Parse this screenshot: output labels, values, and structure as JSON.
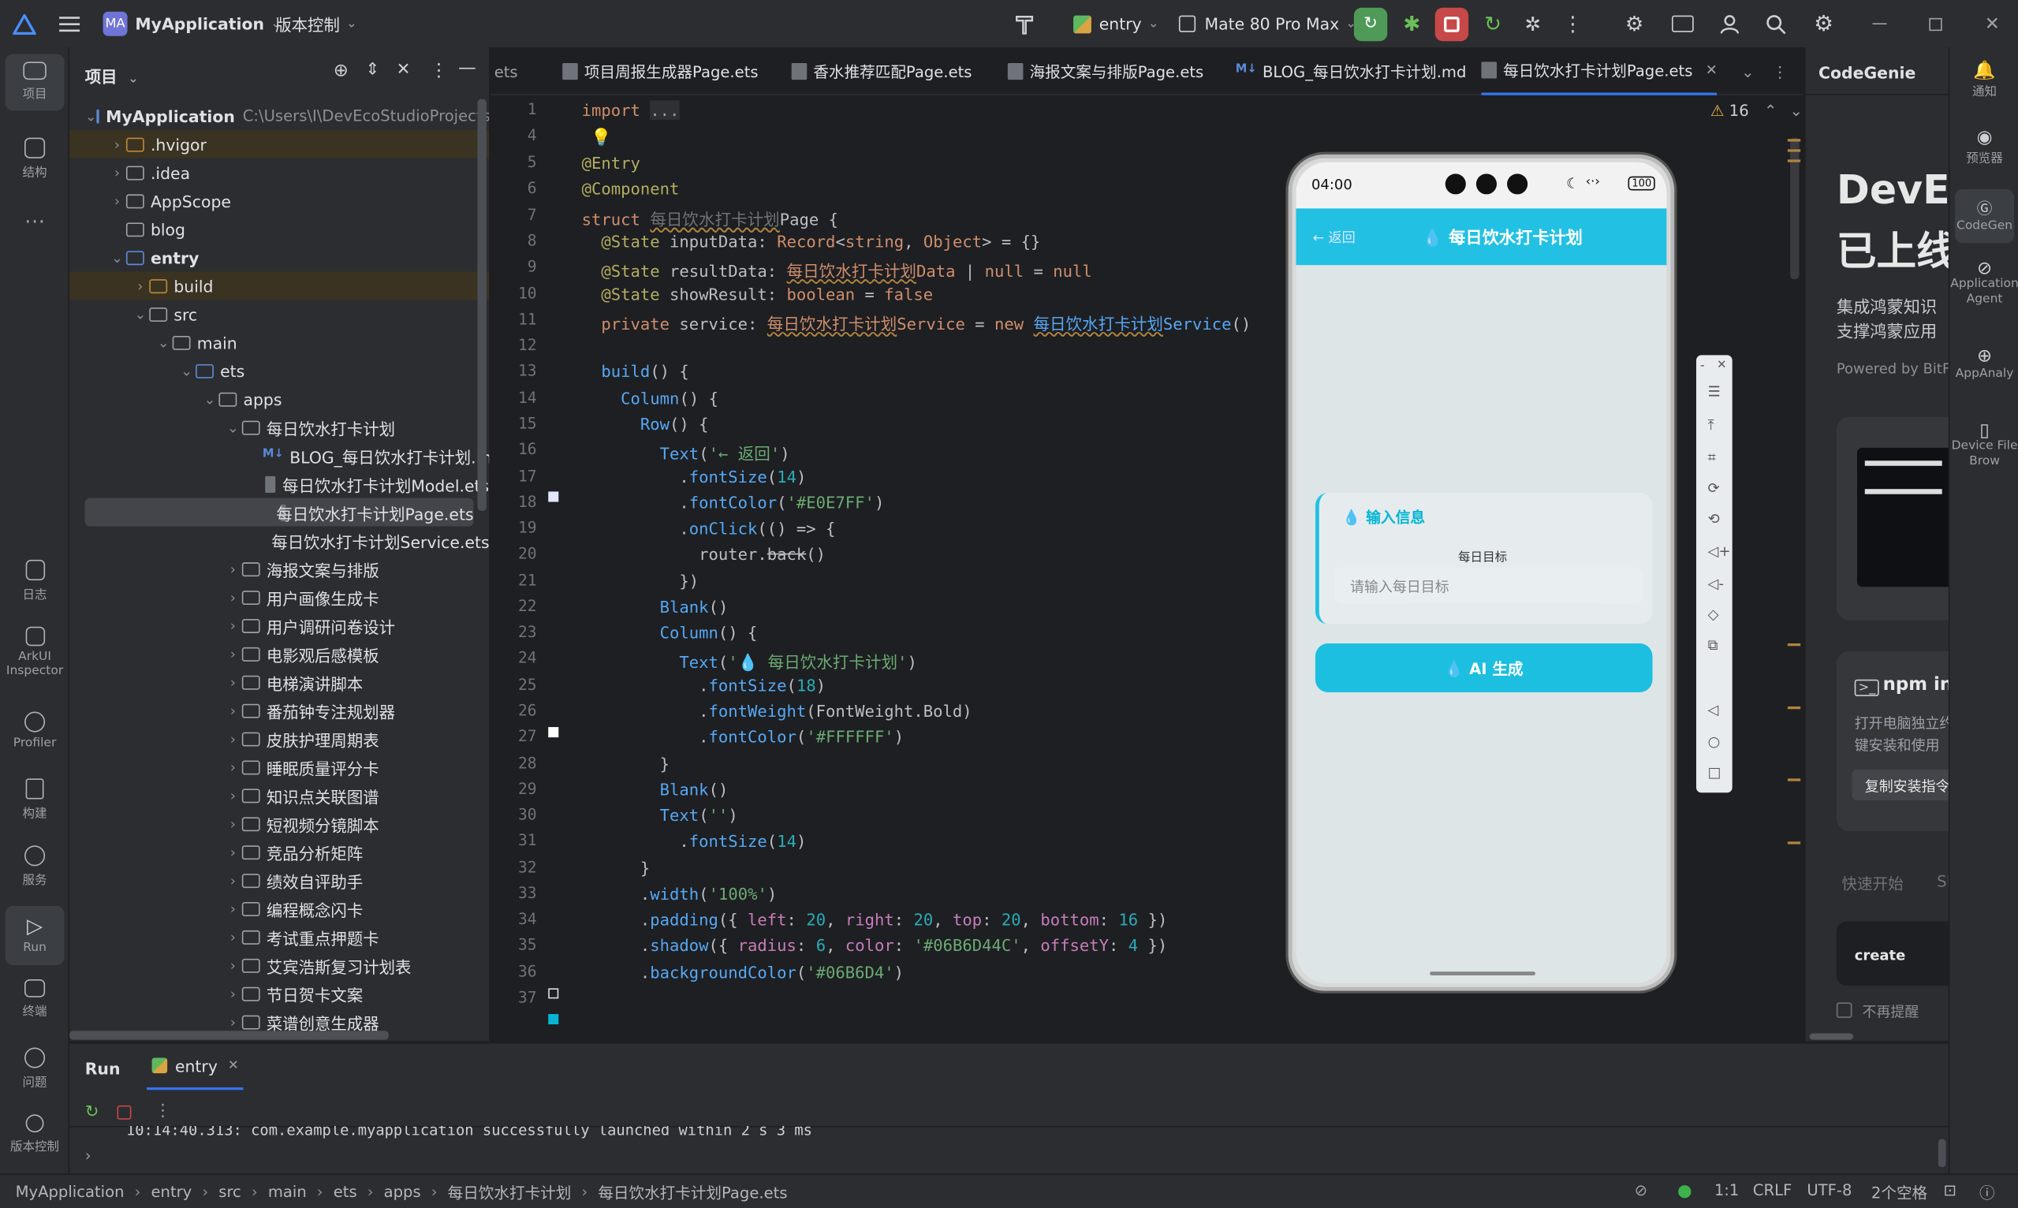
{
  "titlebar": {
    "project_badge": "MA",
    "project_name": "MyApplication",
    "vcs": "版本控制",
    "run_config": "entry",
    "device": "Mate 80 Pro Max"
  },
  "leftbar": {
    "items": [
      "项目",
      "结构",
      "日志",
      "ArkUI Inspector",
      "Profiler",
      "构建",
      "服务",
      "Run",
      "终端",
      "问题",
      "版本控制"
    ]
  },
  "project_panel": {
    "title": "项目",
    "root": "MyApplication",
    "root_path": "C:\\Users\\I\\DevEcoStudioProjects\\My",
    "tree": [
      ".hvigor",
      ".idea",
      "AppScope",
      "blog",
      "entry",
      "build",
      "src",
      "main",
      "ets",
      "apps",
      "每日饮水打卡计划",
      "BLOG_每日饮水打卡计划.md",
      "每日饮水打卡计划Model.ets",
      "每日饮水打卡计划Page.ets",
      "每日饮水打卡计划Service.ets",
      "海报文案与排版",
      "用户画像生成卡",
      "用户调研问卷设计",
      "电影观后感模板",
      "电梯演讲脚本",
      "番茄钟专注规划器",
      "皮肤护理周期表",
      "睡眠质量评分卡",
      "知识点关联图谱",
      "短视频分镜脚本",
      "竞品分析矩阵",
      "绩效自评助手",
      "编程概念闪卡",
      "考试重点押题卡",
      "艾宾浩斯复习计划表",
      "节日贺卡文案",
      "菜谱创意生成器"
    ]
  },
  "tabs": [
    "ets",
    "项目周报生成器Page.ets",
    "香水推荐匹配Page.ets",
    "海报文案与排版Page.ets",
    "BLOG_每日饮水打卡计划.md",
    "每日饮水打卡计划Page.ets"
  ],
  "editor": {
    "warnings": "16",
    "line_numbers": [
      "1",
      "4",
      "5",
      "6",
      "7",
      "8",
      "9",
      "10",
      "11",
      "12",
      "13",
      "14",
      "15",
      "16",
      "17",
      "18",
      "19",
      "20",
      "21",
      "22",
      "23",
      "24",
      "25",
      "26",
      "27",
      "28",
      "29",
      "30",
      "31",
      "32",
      "33",
      "34",
      "35",
      "36",
      "37"
    ]
  },
  "preview": {
    "time": "04:00",
    "battery": "100",
    "back_label": "← 返回",
    "title": "💧 每日饮水打卡计划",
    "card_title": "💧 输入信息",
    "field_label": "每日目标",
    "field_placeholder": "请输入每日目标",
    "button_label": "💧 AI 生成"
  },
  "codegenie": {
    "title": "CodeGenie",
    "heading1": "DevEc",
    "heading2": "已上线",
    "desc1": "集成鸿蒙知识",
    "desc2": "支撑鸿蒙应用",
    "powered": "Powered by BitFu",
    "npm_title": "npm ins",
    "npm_desc1": "打开电脑独立约",
    "npm_desc2": "键安装和使用",
    "copy_btn": "复制安装指令",
    "quick_start": "快速开始",
    "quick_si": "Sl",
    "create": "create",
    "no_remind": "不再提醒"
  },
  "rightbar": {
    "items": [
      "通知",
      "预览器",
      "CodeGen",
      "Application Agent",
      "AppAnaly",
      "Device File Brow"
    ]
  },
  "run_panel": {
    "title": "Run",
    "tab": "entry",
    "log": "10:14:40.313: com.example.myapplication successfully launched within 2 s 3 ms"
  },
  "statusbar": {
    "crumbs": [
      "MyApplication",
      "entry",
      "src",
      "main",
      "ets",
      "apps",
      "每日饮水打卡计划",
      "每日饮水打卡计划Page.ets"
    ],
    "position": "1:1",
    "line_sep": "CRLF",
    "encoding": "UTF-8",
    "indent": "2个空格"
  }
}
